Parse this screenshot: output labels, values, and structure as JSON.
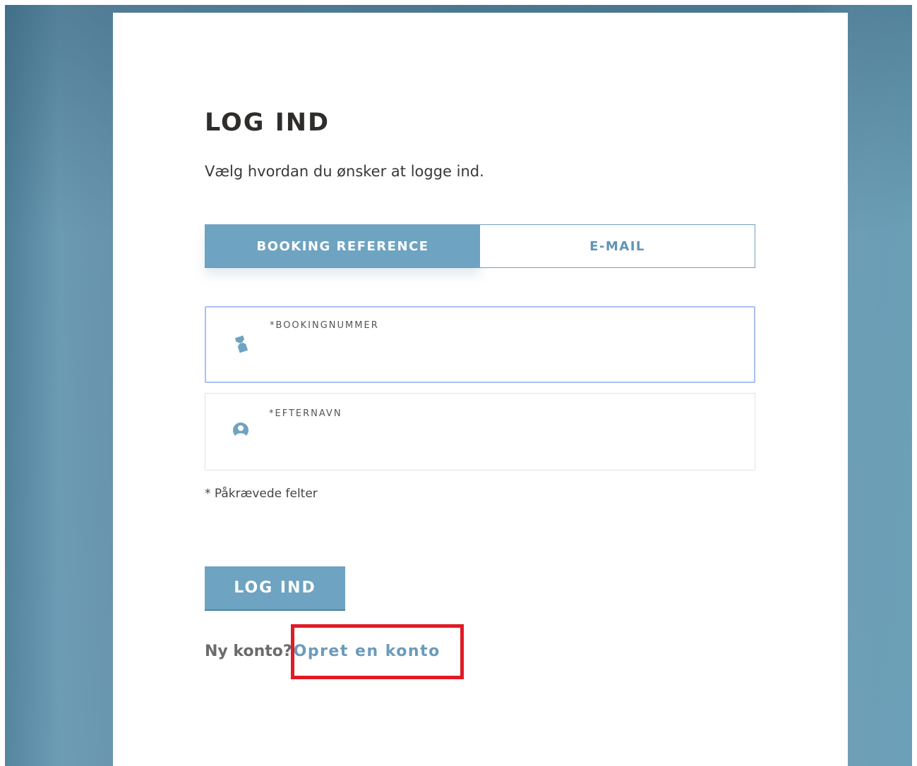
{
  "login": {
    "title": "LOG IND",
    "subtitle": "Vælg hvordan du ønsker at logge ind.",
    "tabs": [
      {
        "label": "BOOKING REFERENCE",
        "active": true
      },
      {
        "label": "E-MAIL",
        "active": false
      }
    ],
    "fields": {
      "booking_number": {
        "label": "*BOOKINGNUMMER",
        "value": "",
        "icon": "ticket-icon"
      },
      "last_name": {
        "label": "*EFTERNAVN",
        "value": "",
        "icon": "user-icon"
      }
    },
    "required_note": "* Påkrævede felter",
    "submit_label": "LOG IND",
    "new_account": {
      "question": "Ny konto?",
      "link_label": "Opret en konto"
    }
  },
  "colors": {
    "accent": "#6ea3c1",
    "link": "#6a9bb9",
    "focus_border": "#a9c1ee",
    "highlight": "#e01b24",
    "title_text": "#2f2d2b"
  }
}
